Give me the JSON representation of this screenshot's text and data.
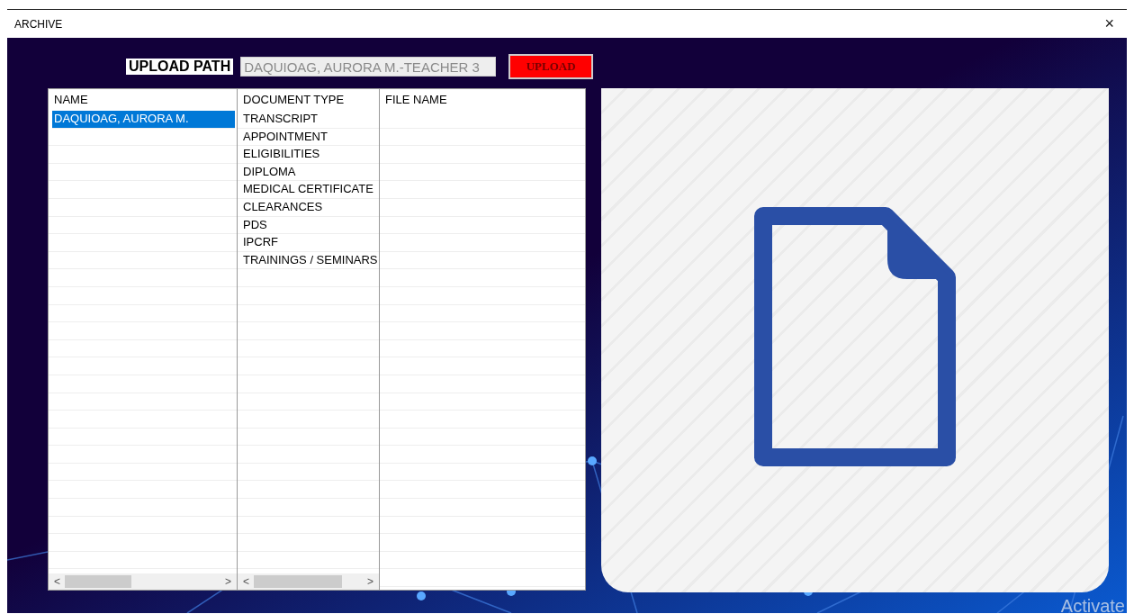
{
  "window": {
    "title": "ARCHIVE",
    "close": "×"
  },
  "upload": {
    "label": "UPLOAD PATH",
    "value": "DAQUIOAG, AURORA M.-TEACHER 3",
    "button": "UPLOAD"
  },
  "names": {
    "header": "NAME",
    "items": [
      {
        "text": "DAQUIOAG, AURORA M.",
        "selected": true
      }
    ]
  },
  "document_types": {
    "header": "DOCUMENT TYPE",
    "items": [
      "TRANSCRIPT",
      "APPOINTMENT",
      "ELIGIBILITIES",
      "DIPLOMA",
      "MEDICAL CERTIFICATE",
      "CLEARANCES",
      "PDS",
      "IPCRF",
      "TRAININGS / SEMINARS"
    ]
  },
  "file_names": {
    "header": "FILE NAME"
  },
  "scroll_arrows": {
    "left": "<",
    "right": ">"
  },
  "activation_notice": "Activate"
}
